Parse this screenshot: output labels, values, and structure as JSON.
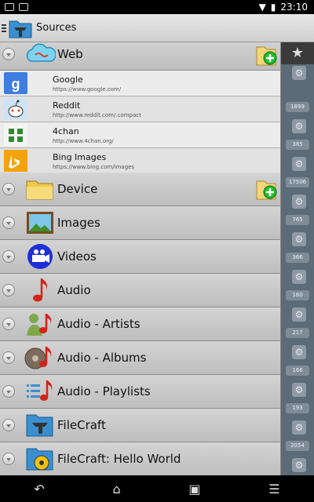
{
  "status_bar": {
    "time": "23:10"
  },
  "action_bar": {
    "title": "Sources"
  },
  "drawer": {
    "web": {
      "label": "Web",
      "children": [
        {
          "name": "Google",
          "url": "https://www.google.com/",
          "icon": "google-icon"
        },
        {
          "name": "Reddit",
          "url": "http://www.reddit.com/.compact",
          "icon": "reddit-icon"
        },
        {
          "name": "4chan",
          "url": "http://www.4chan.org/",
          "icon": "4chan-icon"
        },
        {
          "name": "Bing Images",
          "url": "https://www.bing.com/images",
          "icon": "bing-icon"
        }
      ]
    },
    "items": [
      {
        "label": "Device",
        "icon": "folder-icon"
      },
      {
        "label": "Images",
        "icon": "picture-icon"
      },
      {
        "label": "Videos",
        "icon": "video-camera-icon"
      },
      {
        "label": "Audio",
        "icon": "music-note-icon"
      },
      {
        "label": "Audio - Artists",
        "icon": "artist-icon"
      },
      {
        "label": "Audio - Albums",
        "icon": "album-disc-icon"
      },
      {
        "label": "Audio - Playlists",
        "icon": "playlist-icon"
      },
      {
        "label": "FileCraft",
        "icon": "filecraft-folder-icon"
      },
      {
        "label": "FileCraft: Hello World",
        "icon": "filecraft-hello-icon"
      }
    ]
  },
  "background_list": {
    "counts": [
      "1899",
      "385",
      "17506",
      "765",
      "366",
      "160",
      "217",
      "166",
      "193",
      "2054"
    ]
  }
}
